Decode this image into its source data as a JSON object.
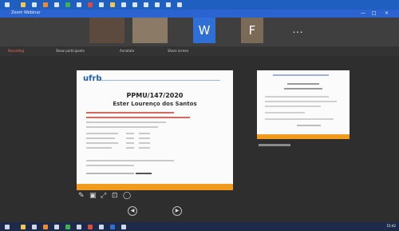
{
  "title_bar": {
    "window_title": "Zoom Webinar",
    "controls": [
      "—",
      "□",
      "×"
    ]
  },
  "participants": [
    {
      "type": "video",
      "name": ""
    },
    {
      "type": "video",
      "name": ""
    },
    {
      "type": "initial",
      "letter": "W",
      "color": "#2f6fd6"
    },
    {
      "type": "initial",
      "letter": "F",
      "color": "#7b6a58"
    }
  ],
  "participants_more": "• • •",
  "toolbar_items": [
    "Recording",
    "Show participants",
    "Annotate",
    "Share screen"
  ],
  "main_slide": {
    "logo": "ufrb",
    "heading": "PPMU/147/2020",
    "name": "Ester Lourenço dos Santos",
    "footer_color": "#f29a1e"
  },
  "side_slide": {
    "heading": "",
    "footer_color": "#f29a1e"
  },
  "annotation_tools": [
    "✎",
    "▣",
    "⤢",
    "⊡",
    "◯"
  ],
  "navigation": {
    "prev": "◀",
    "next": "▶",
    "page_indicator": ""
  },
  "clock": "15:42"
}
